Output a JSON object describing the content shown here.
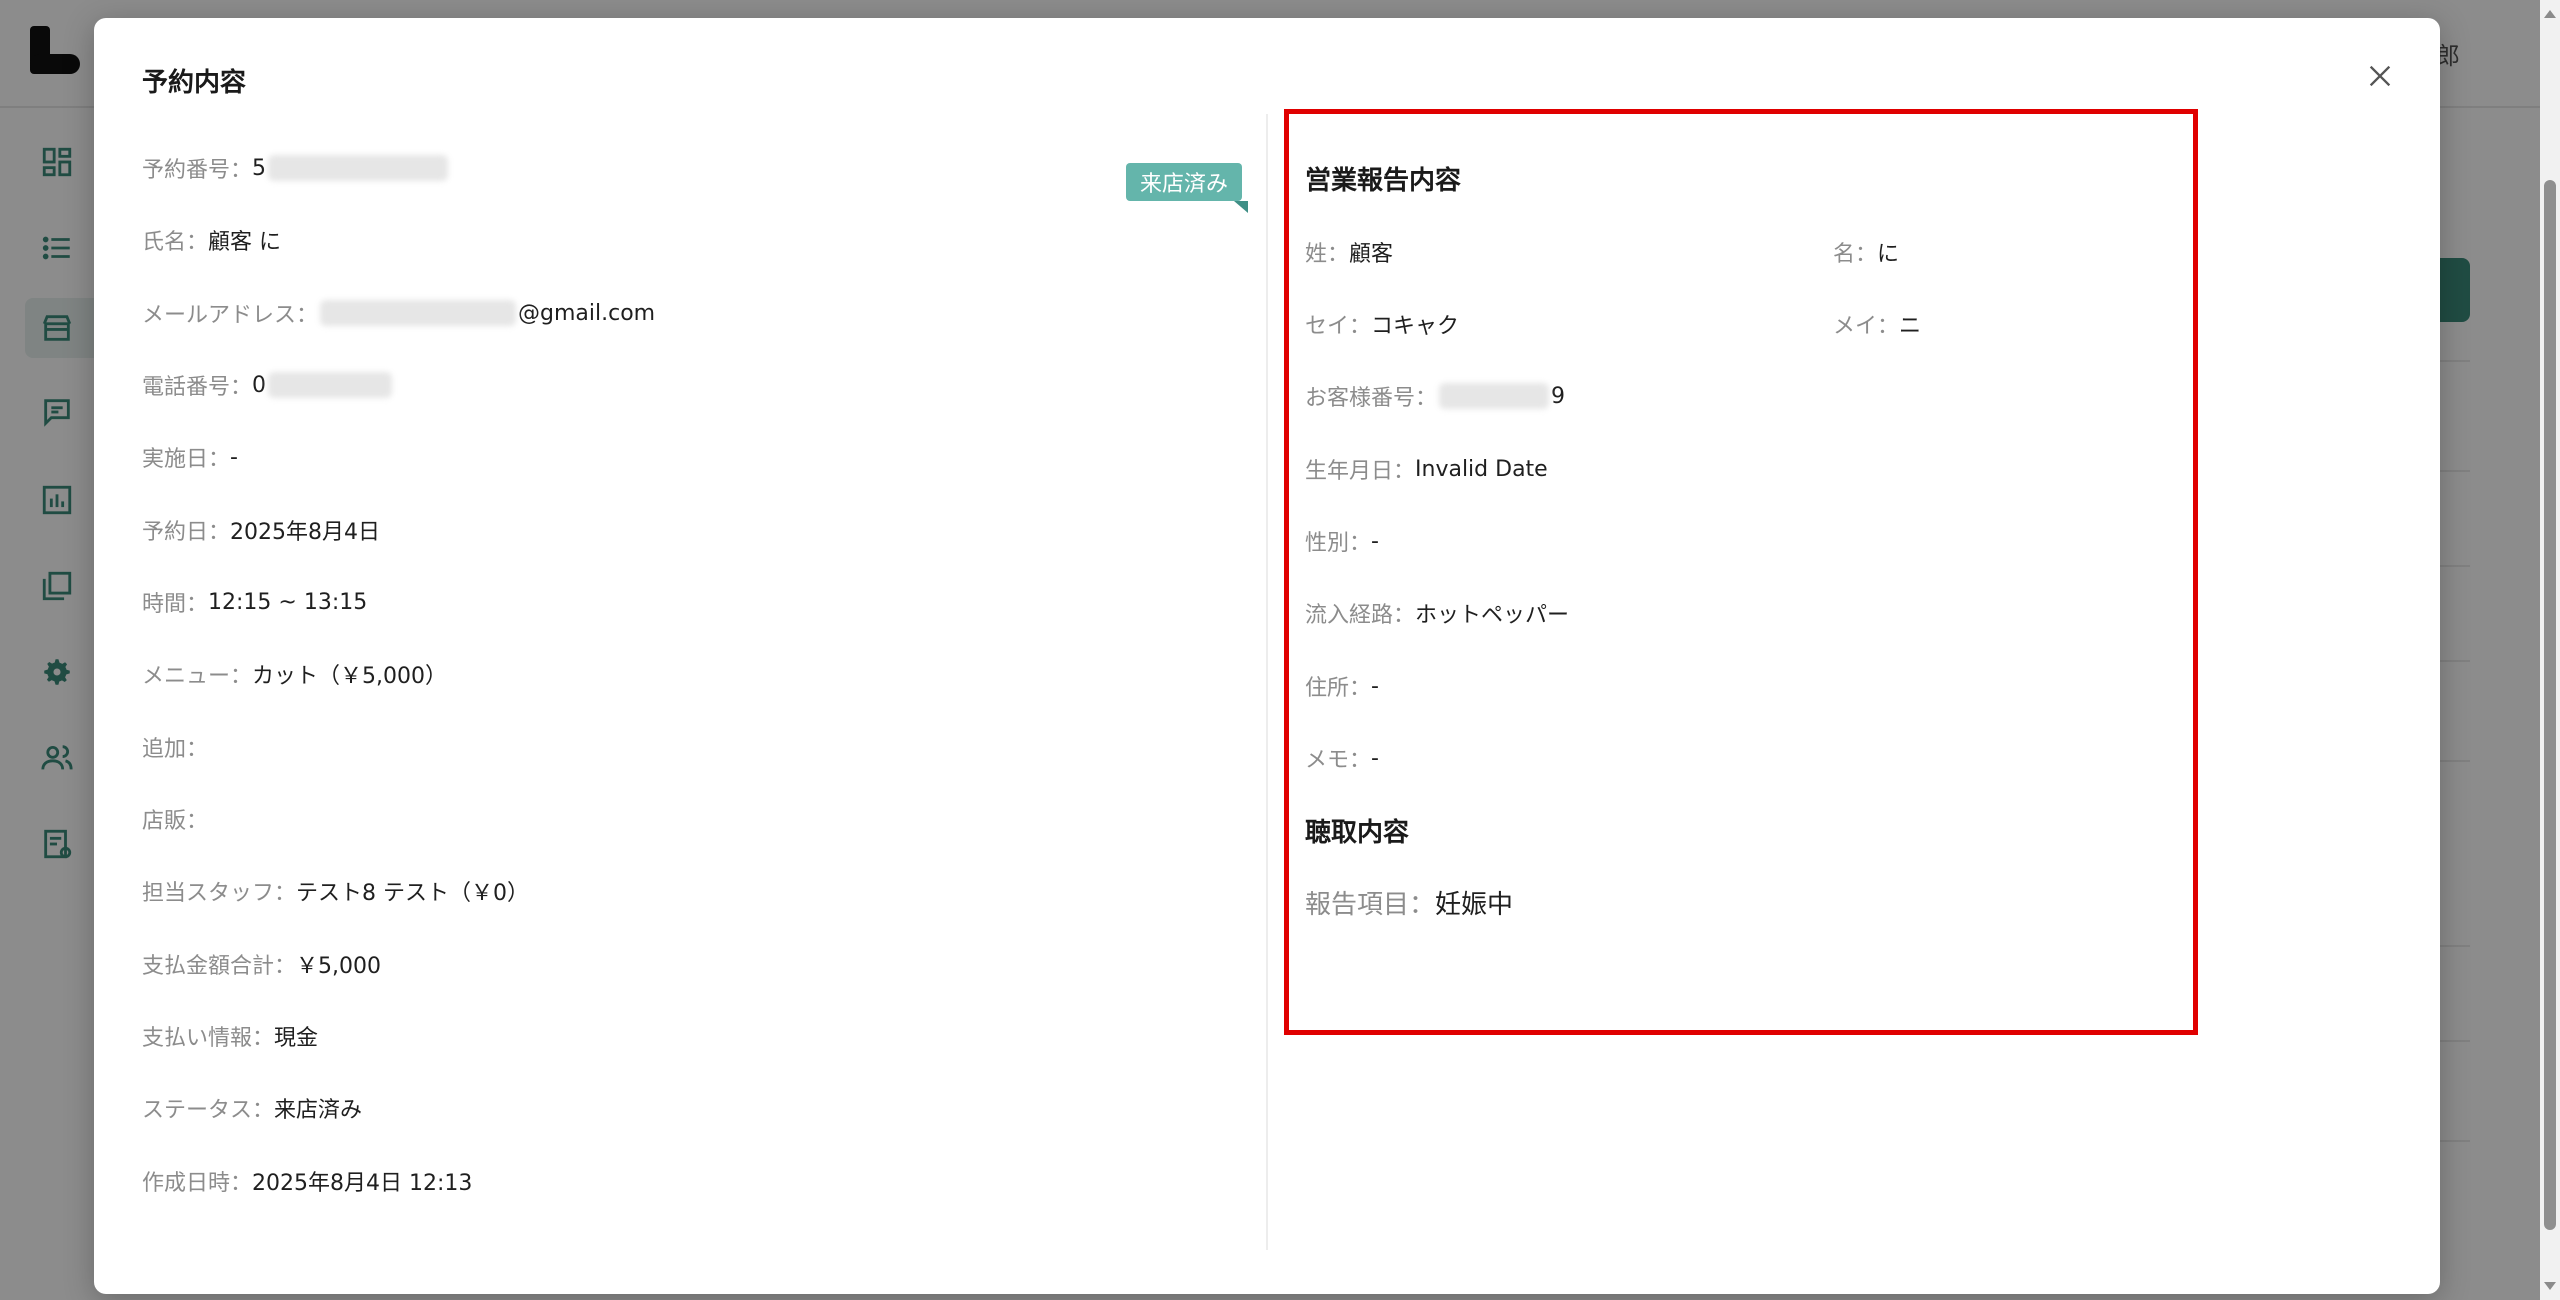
{
  "background": {
    "user_name": "太郎",
    "nav_icons": [
      "dashboard-icon",
      "list-icon",
      "store-icon",
      "chat-icon",
      "chart-icon",
      "gallery-icon",
      "gear-icon",
      "users-icon",
      "report-icon"
    ],
    "accent_color": "#3b8a7a"
  },
  "modal": {
    "title": "予約内容",
    "close_icon": "close-icon",
    "status_tag": "来店済み",
    "status_tag_color": "#64b5ab",
    "left_fields": [
      {
        "label": "予約番号：",
        "value": "5"
      },
      {
        "label": "氏名：",
        "value": "顧客 に"
      },
      {
        "label": "メールアドレス：",
        "value": "@gmail.com"
      },
      {
        "label": "電話番号：",
        "value": "0"
      },
      {
        "label": "実施日：",
        "value": "-"
      },
      {
        "label": "予約日：",
        "value": "2025年8月4日"
      },
      {
        "label": "時間：",
        "value": "12:15 ~ 13:15"
      },
      {
        "label": "メニュー：",
        "value": "カット（￥5,000）"
      },
      {
        "label": "追加：",
        "value": ""
      },
      {
        "label": "店販：",
        "value": ""
      },
      {
        "label": "担当スタッフ：",
        "value": "テスト8 テスト（￥0）"
      },
      {
        "label": "支払金額合計：",
        "value": "￥5,000"
      },
      {
        "label": "支払い情報：",
        "value": "現金"
      },
      {
        "label": "ステータス：",
        "value": "来店済み"
      },
      {
        "label": "作成日時：",
        "value": "2025年8月4日 12:13"
      }
    ],
    "report": {
      "title": "営業報告内容",
      "last_name": {
        "label": "姓：",
        "value": "顧客"
      },
      "first_name": {
        "label": "名：",
        "value": "に"
      },
      "last_name_kana": {
        "label": "セイ：",
        "value": "コキャク"
      },
      "first_name_kana": {
        "label": "メイ：",
        "value": "ニ"
      },
      "customer_number": {
        "label": "お客様番号：",
        "value": "9"
      },
      "birthday": {
        "label": "生年月日：",
        "value": "Invalid Date"
      },
      "gender": {
        "label": "性別：",
        "value": "-"
      },
      "source": {
        "label": "流入経路：",
        "value": "ホットペッパー"
      },
      "address": {
        "label": "住所：",
        "value": "-"
      },
      "memo": {
        "label": "メモ：",
        "value": "-"
      },
      "hearing_title": "聴取内容",
      "report_item": {
        "label": "報告項目：",
        "value": "妊娠中"
      }
    },
    "highlight_color": "#e00000"
  }
}
